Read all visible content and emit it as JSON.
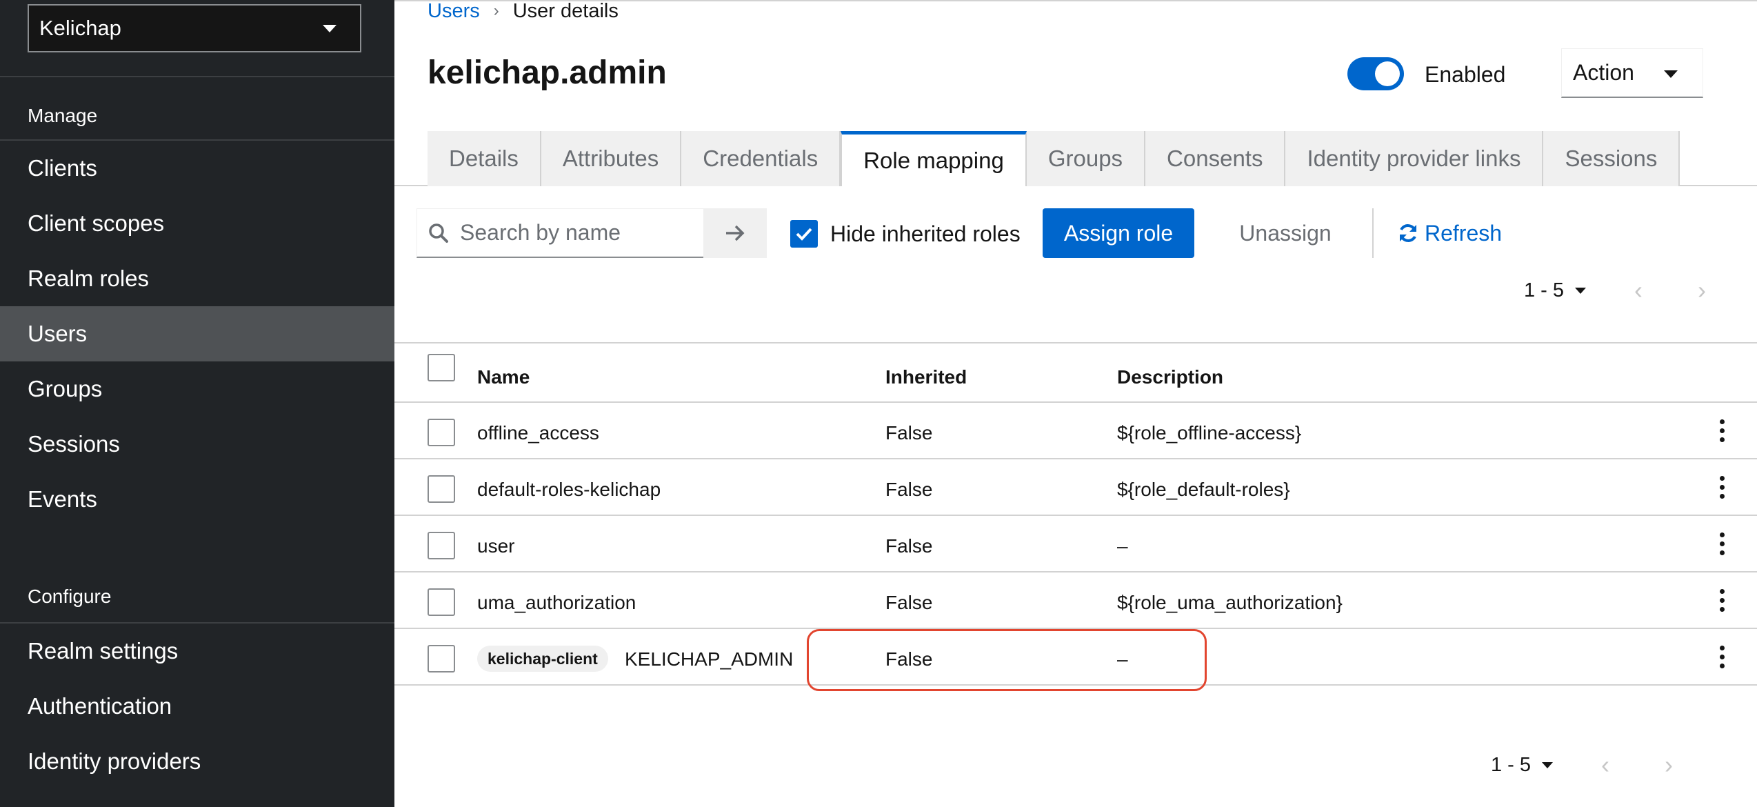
{
  "sidebar": {
    "realm": "Kelichap",
    "sections": {
      "manage": "Manage",
      "configure": "Configure"
    },
    "manage_items": [
      "Clients",
      "Client scopes",
      "Realm roles",
      "Users",
      "Groups",
      "Sessions",
      "Events"
    ],
    "configure_items": [
      "Realm settings",
      "Authentication",
      "Identity providers"
    ],
    "active_item": "Users"
  },
  "breadcrumb": {
    "parent": "Users",
    "current": "User details"
  },
  "page": {
    "title": "kelichap.admin"
  },
  "header": {
    "enabled_label": "Enabled",
    "enabled": true,
    "action_label": "Action"
  },
  "tabs": [
    "Details",
    "Attributes",
    "Credentials",
    "Role mapping",
    "Groups",
    "Consents",
    "Identity provider links",
    "Sessions"
  ],
  "active_tab": "Role mapping",
  "toolbar": {
    "search_placeholder": "Search by name",
    "hide_inherited_label": "Hide inherited roles",
    "hide_inherited_checked": true,
    "assign_label": "Assign role",
    "unassign_label": "Unassign",
    "refresh_label": "Refresh"
  },
  "pagination": {
    "range": "1 - 5",
    "prev": "‹",
    "next": "›"
  },
  "table": {
    "columns": [
      "Name",
      "Inherited",
      "Description"
    ],
    "rows": [
      {
        "client": "",
        "name": "offline_access",
        "inherited": "False",
        "description": "${role_offline-access}"
      },
      {
        "client": "",
        "name": "default-roles-kelichap",
        "inherited": "False",
        "description": "${role_default-roles}"
      },
      {
        "client": "",
        "name": "user",
        "inherited": "False",
        "description": "–"
      },
      {
        "client": "",
        "name": "uma_authorization",
        "inherited": "False",
        "description": "${role_uma_authorization}"
      },
      {
        "client": "kelichap-client",
        "name": "KELICHAP_ADMIN",
        "inherited": "False",
        "description": "–"
      }
    ]
  },
  "colors": {
    "accent": "#0066cc",
    "sidebar_bg": "#212427",
    "highlight": "#e2452f"
  }
}
